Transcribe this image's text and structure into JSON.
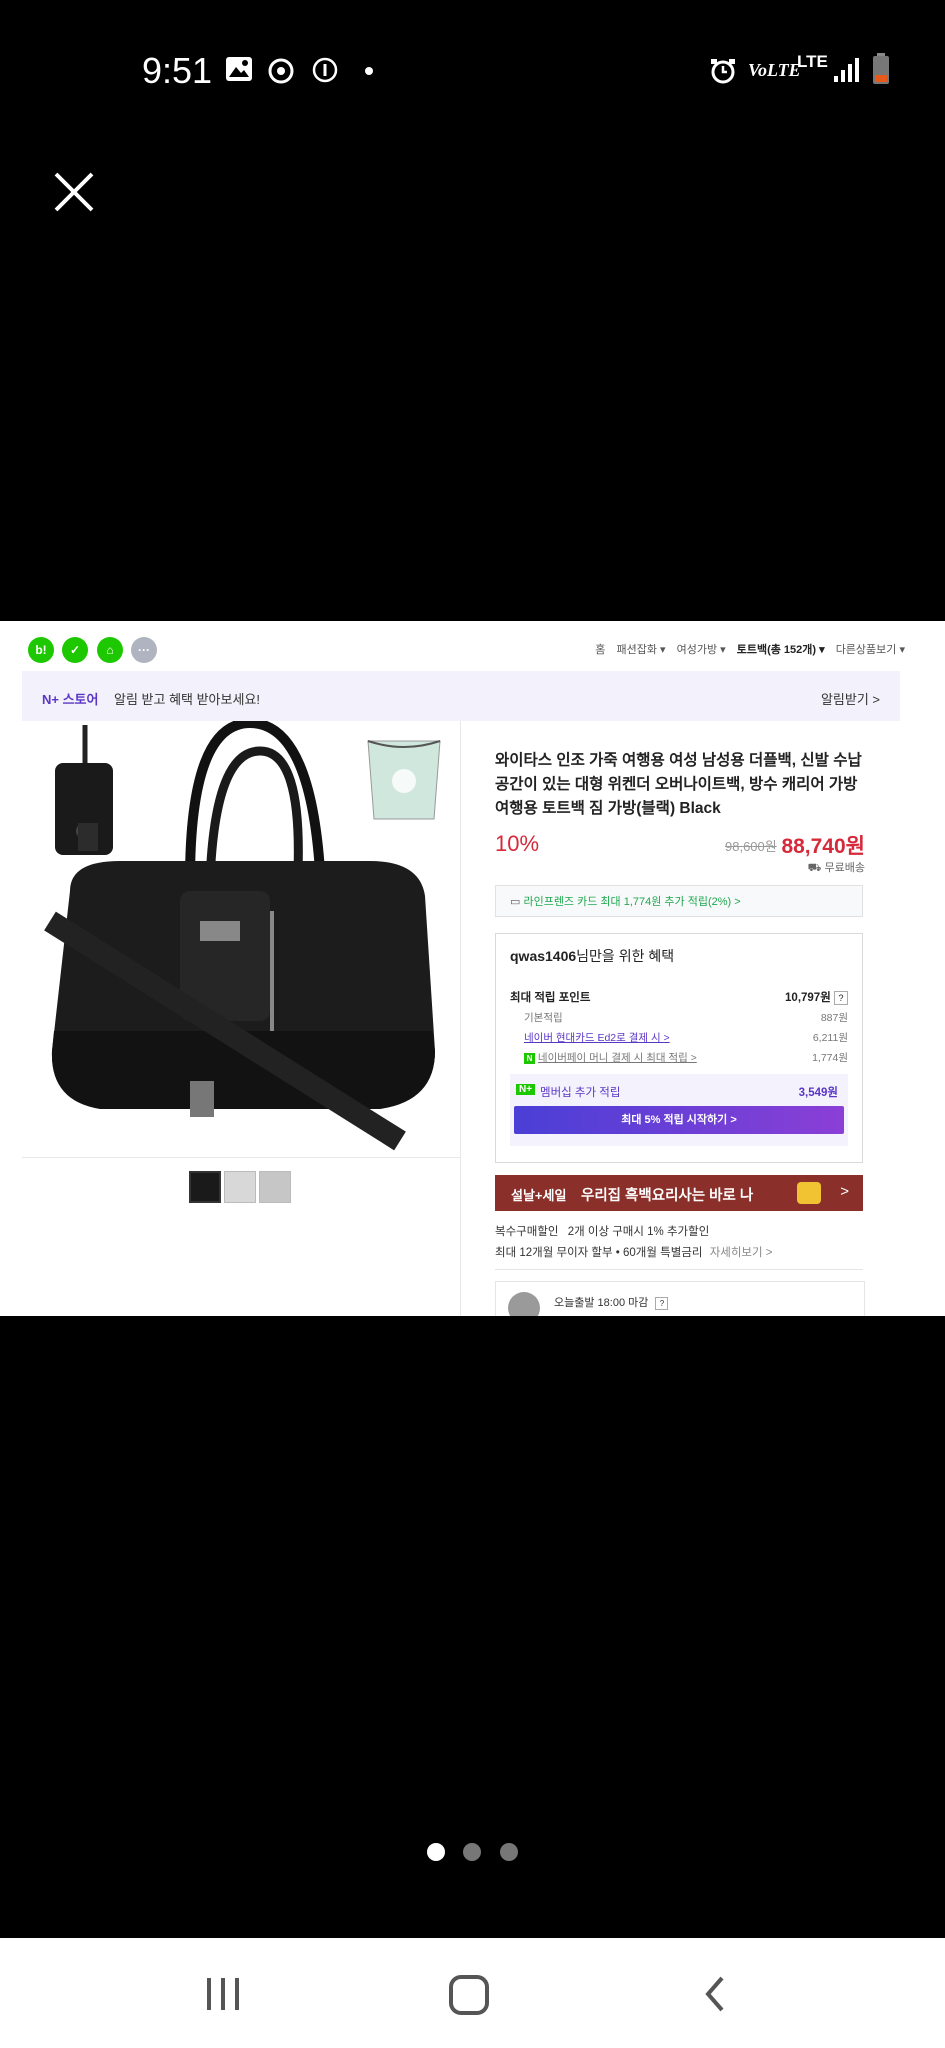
{
  "statusbar": {
    "time": "9:51",
    "network_label": "VoLTE",
    "lte_label": "LTE",
    "icons": [
      "image-icon",
      "sync-icon",
      "info-icon",
      "dot-icon",
      "alarm-icon",
      "volte-icon",
      "lte-icon",
      "signal-icon",
      "battery-icon"
    ]
  },
  "viewer": {
    "close_icon": "close-icon",
    "page_count": 3,
    "current_page": 1
  },
  "store": {
    "topnav": {
      "circles": [
        "b!",
        "✓",
        "⌂",
        "···"
      ],
      "breadcrumbs": [
        "홈",
        "패션잡화 ▾",
        "여성가방 ▾",
        "토트백(총 152개) ▾",
        "다른상품보기 ▾"
      ]
    },
    "banner": {
      "badge": "N+ 스토어",
      "message": "알림 받고 혜택 받아보세요!",
      "action": "알림받기 >"
    },
    "product": {
      "title": "와이타스 인조 가죽 여행용 여성 남성용 더플백, 신발 수납공간이 있는 대형 위켄더 오버나이트백, 방수 캐리어 가방 여행용 토트백 짐 가방(블랙) Black",
      "discount": "10%",
      "original_price": "98,600원",
      "price": "88,740원",
      "shipping": "무료배송",
      "card_offer": "라인프렌즈 카드 최대 1,774원 추가 적립(2%) >"
    },
    "benefit": {
      "user": "qwas1406",
      "head_suffix": "님만을 위한 혜택",
      "max_points_label": "최대 적립 포인트",
      "max_points_value": "10,797원",
      "help": "?",
      "rows": [
        {
          "label": "기본적립",
          "value": "887원"
        },
        {
          "label": "네이버 현대카드 Ed2로 결제 시 >",
          "value": "6,211원"
        },
        {
          "label": "네이버페이 머니 결제 시 최대 적립 >",
          "value": "1,774원"
        }
      ],
      "member_label": "멤버십 추가 적립",
      "member_value": "3,549원",
      "member_button": "최대 5% 적립 시작하기 >"
    },
    "sale_banner": {
      "tag": "설날+세일",
      "text": "우리집 흑백요리사는 바로 나",
      "arrow": ">"
    },
    "info": {
      "bulk_label": "복수구매할인",
      "bulk_text": "2개 이상 구매시 1% 추가할인",
      "installment": "최대 12개월 무이자 할부 • 60개월 특별금리",
      "more": "자세히보기 >"
    },
    "delivery": {
      "text": "오늘출발 18:00 마감",
      "help": "?"
    }
  },
  "colors": {
    "accent": "#d6293a",
    "naver_green": "#1ec800",
    "purple": "#5a36c7"
  },
  "navbar": {
    "icons": [
      "recent-apps-icon",
      "home-icon",
      "back-icon"
    ]
  }
}
